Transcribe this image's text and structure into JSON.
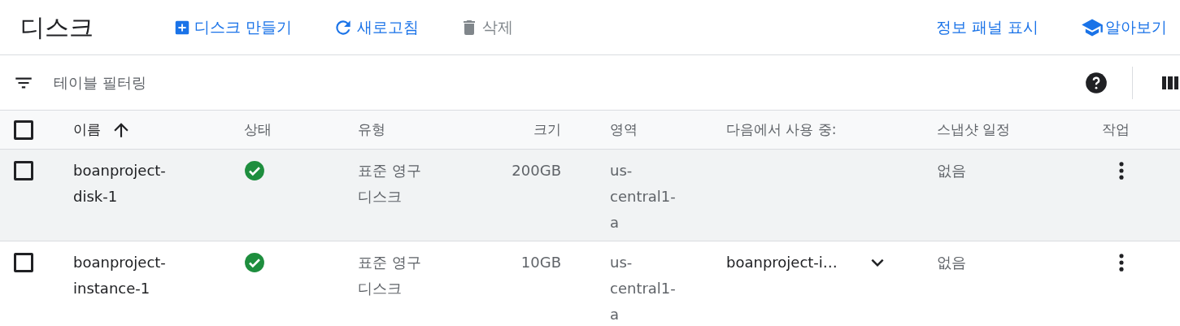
{
  "page_title": "디스크",
  "toolbar": [
    {
      "label": "디스크 만들기",
      "kind": "create",
      "disabled": false
    },
    {
      "label": "새로고침",
      "kind": "refresh",
      "disabled": false
    },
    {
      "label": "삭제",
      "kind": "delete",
      "disabled": true
    }
  ],
  "toolbar_right": [
    {
      "label": "정보 패널 표시",
      "kind": "plain"
    },
    {
      "label": "알아보기",
      "kind": "learn"
    }
  ],
  "filter": {
    "placeholder": "테이블 필터링"
  },
  "table": {
    "header_checked": false,
    "columns": [
      {
        "label": "이름",
        "sorted": true
      },
      {
        "label": "상태",
        "sorted": false
      },
      {
        "label": "유형",
        "sorted": false
      },
      {
        "label": "크기",
        "sorted": false
      },
      {
        "label": "영역",
        "sorted": false
      },
      {
        "label": "다음에서 사용 중:",
        "sorted": false
      },
      {
        "label": "스냅샷 일정",
        "sorted": false
      },
      {
        "label": "작업",
        "sorted": false
      }
    ],
    "rows": [
      {
        "checked": false,
        "hovered": true,
        "name": "boanproject-disk-1",
        "healthy": true,
        "type": "표준 영구 디스크",
        "size": "200GB",
        "zone": "us-central1-a",
        "expandable": false,
        "snapshot": "없음"
      },
      {
        "checked": false,
        "hovered": false,
        "name": "boanproject-instance-1",
        "healthy": true,
        "type": "표준 영구 디스크",
        "size": "10GB",
        "zone": "us-central1-a",
        "in_use": "boanproject-i…",
        "expandable": true,
        "snapshot": "없음"
      }
    ]
  }
}
